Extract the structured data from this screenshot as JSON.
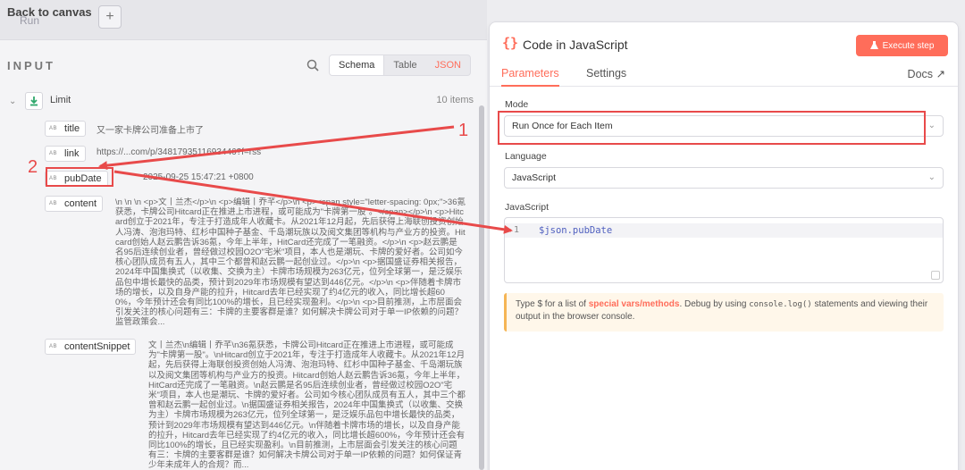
{
  "topbar": {
    "back_label": "Back to canvas",
    "ghost_label": "Run",
    "plus_label": "+"
  },
  "input": {
    "title": "INPUT",
    "view_tabs": [
      "Schema",
      "Table",
      "JSON"
    ],
    "limit_label": "Limit",
    "items_count": "10 items",
    "fields": {
      "title": {
        "name": "title",
        "value": "又一家卡牌公司准备上市了"
      },
      "link": {
        "name": "link",
        "value": "https://...com/p/3481793511693446?f=rss"
      },
      "pubDate": {
        "name": "pubDate",
        "value": "2025-09-25 15:47:21 +0800"
      },
      "content": {
        "name": "content",
        "value": "\\n \\n \\n <p>文丨兰杰</p>\\n <p>编辑丨乔芊</p>\\n <p><span style=\"letter-spacing: 0px;\">36氪获悉，卡牌公司Hitcard正在推进上市进程，或可能成为\"卡牌第一股\"。</span></p>\\n <p>Hitcard创立于2021年，专注于打造成年人收藏卡。从2021年12月起，先后获得上海联创投资创始人冯涛、泡泡玛特、红杉中国种子基金、千岛潮玩族以及阅文集团等机构与产业方的投资。Hitcard创始人赵云鹏告诉36氪，今年上半年，HitCard还完成了一笔融资。</p>\\n <p>赵云鹏是名95后连续创业者，曾经做过校园O2O\"宅米\"项目，本人也是潮玩、卡牌的爱好者。公司如今核心团队成员有五人，其中三个都曾和赵云鹏一起创业过。</p>\\n <p>据国盛证券相关报告，2024年中国集换式（以收集、交换为主）卡牌市场规模为263亿元，位列全球第一，是泛娱乐品包中增长最快的品类，预计到2029年市场规模有望达到446亿元。</p>\\n <p>伴随着卡牌市场的增长，以及自身产能的拉升，Hitcard去年已经实现了约4亿元的收入，同比增长超600%，今年预计还会有同比100%的增长，且已经实现盈利。</p>\\n <p>目前推测，上市层面会引发关注的核心问题有三：卡牌的主要客群是谁？如何解决卡牌公司对于单一IP依赖的问题？监管政策会..."
      },
      "contentSnippet": {
        "name": "contentSnippet",
        "value": "文丨兰杰\\n编辑丨乔芊\\n36氪获悉，卡牌公司Hitcard正在推进上市进程，或可能成为\"卡牌第一股\"。\\nHitcard创立于2021年，专注于打造成年人收藏卡。从2021年12月起，先后获得上海联创投资创始人冯涛、泡泡玛特、红杉中国种子基金、千岛潮玩族以及阅文集团等机构与产业方的投资。Hitcard创始人赵云鹏告诉36氪，今年上半年，HitCard还完成了一笔融资。\\n赵云鹏是名95后连续创业者，曾经做过校园O2O\"宅米\"项目，本人也是潮玩、卡牌的爱好者。公司如今核心团队成员有五人，其中三个都曾和赵云鹏一起创业过。\\n据国盛证券相关报告，2024年中国集换式（以收集、交换为主）卡牌市场规模为263亿元，位列全球第一，是泛娱乐品包中增长最快的品类，预计到2029年市场规模有望达到446亿元。\\n伴随着卡牌市场的增长，以及自身产能的拉升，Hitcard去年已经实现了约4亿元的收入，同比增长超600%，今年预计还会有同比100%的增长，且已经实现盈利。\\n目前推测，上市层面会引发关注的核心问题有三：卡牌的主要客群是谁？如何解决卡牌公司对于单一IP依赖的问题？如何保证青少年未成年人的合规？而..."
      }
    }
  },
  "node": {
    "icon": "{}",
    "title": "Code in JavaScript",
    "execute_label": "Execute step",
    "tabs": [
      "Parameters",
      "Settings"
    ],
    "docs_label": "Docs",
    "mode_label": "Mode",
    "mode_value": "Run Once for Each Item",
    "language_label": "Language",
    "language_value": "JavaScript",
    "code_label": "JavaScript",
    "code_line_no": "1",
    "code_text": "$json.pubDate",
    "hint_prefix": "Type $ for a list of ",
    "hint_link": "special vars/methods",
    "hint_mid": ". Debug by using ",
    "hint_code": "console.log()",
    "hint_suffix": " statements and viewing their output in the browser console."
  },
  "annotations": {
    "num1": "1",
    "num2": "2"
  },
  "colors": {
    "accent": "#ff6d5a",
    "annotation": "#e84a4a"
  }
}
